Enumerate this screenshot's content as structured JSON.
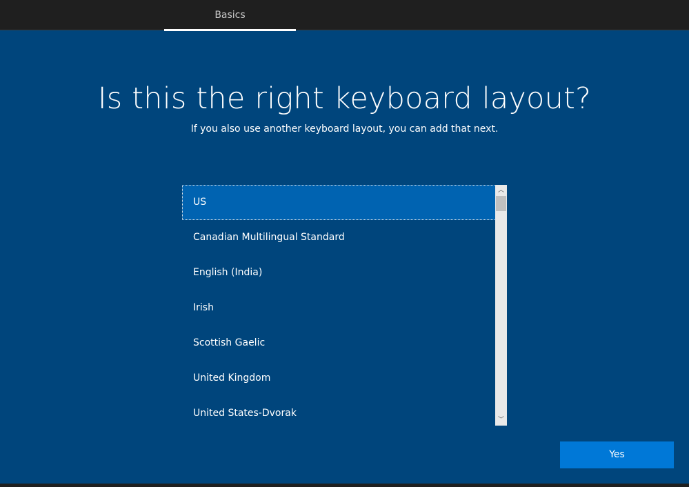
{
  "header": {
    "tabs": [
      {
        "label": "Basics",
        "active": true
      }
    ]
  },
  "main": {
    "title": "Is this the right keyboard layout?",
    "subtitle": "If you also use another keyboard layout, you can add that next."
  },
  "layouts": {
    "selected_index": 0,
    "items": [
      {
        "label": "US"
      },
      {
        "label": "Canadian Multilingual Standard"
      },
      {
        "label": "English (India)"
      },
      {
        "label": "Irish"
      },
      {
        "label": "Scottish Gaelic"
      },
      {
        "label": "United Kingdom"
      },
      {
        "label": "United States-Dvorak"
      }
    ]
  },
  "scrollbar": {
    "up_glyph": "︿",
    "down_glyph": "﹀"
  },
  "footer": {
    "yes_label": "Yes"
  },
  "colors": {
    "background": "#00457c",
    "header": "#1f1f1f",
    "selection": "#0063b1",
    "button": "#0078d7"
  }
}
